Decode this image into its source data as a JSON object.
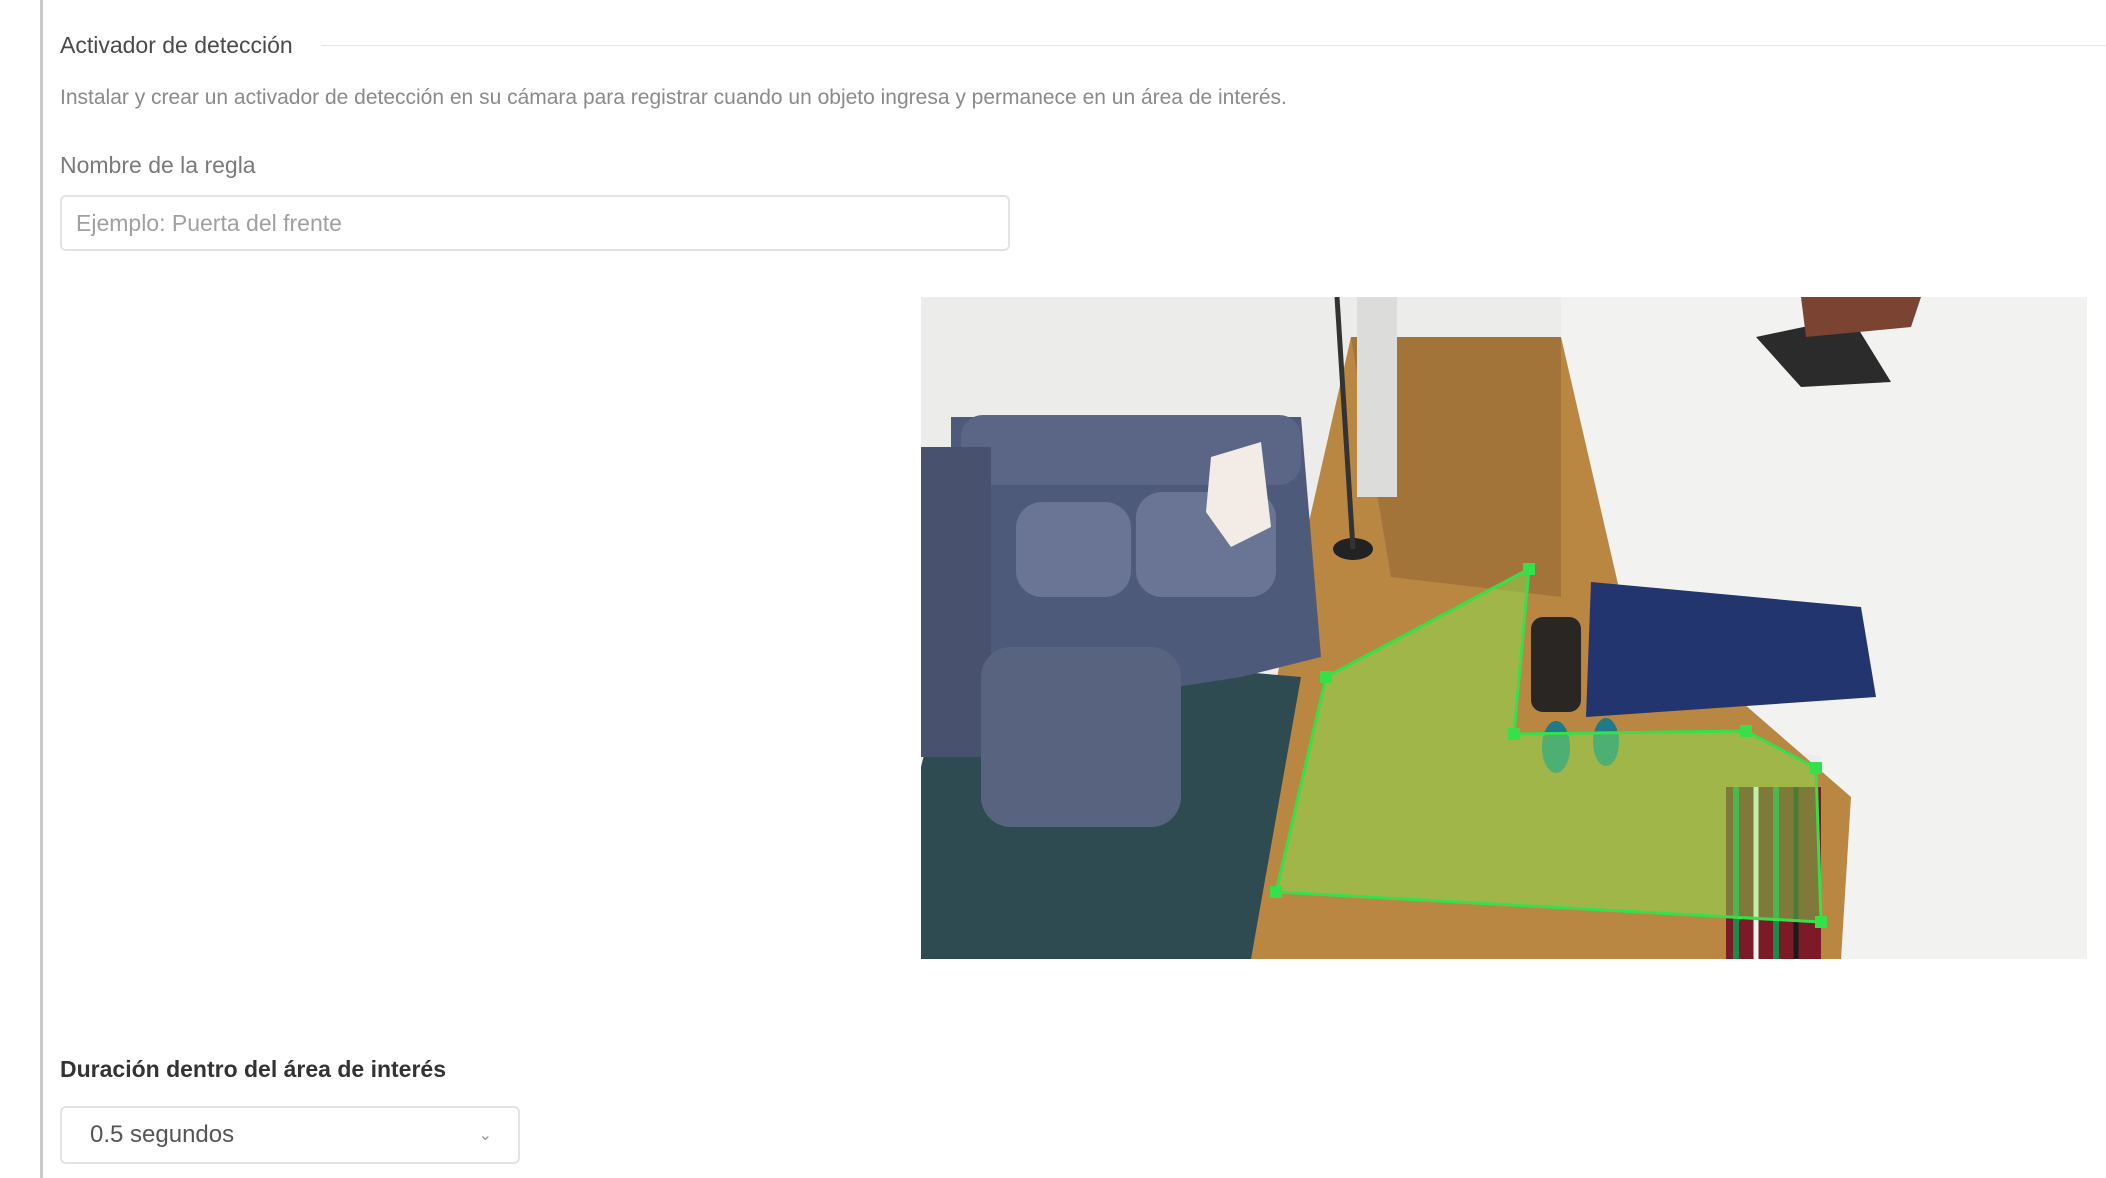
{
  "section": {
    "title": "Activador de detección",
    "description": "Instalar y crear un activador de detección en su cámara para registrar cuando un objeto ingresa y permanece en un área de interés."
  },
  "rule_name": {
    "label": "Nombre de la regla",
    "value": "",
    "placeholder": "Ejemplo: Puerta del frente"
  },
  "camera": {
    "overlay_text": "",
    "zone_color": "#35e04a"
  },
  "duration": {
    "label": "Duración dentro del área de interés",
    "selected": "0.5 segundos"
  },
  "colors": {
    "border": "#e3e3e3",
    "muted_text": "#8a8a8a"
  }
}
